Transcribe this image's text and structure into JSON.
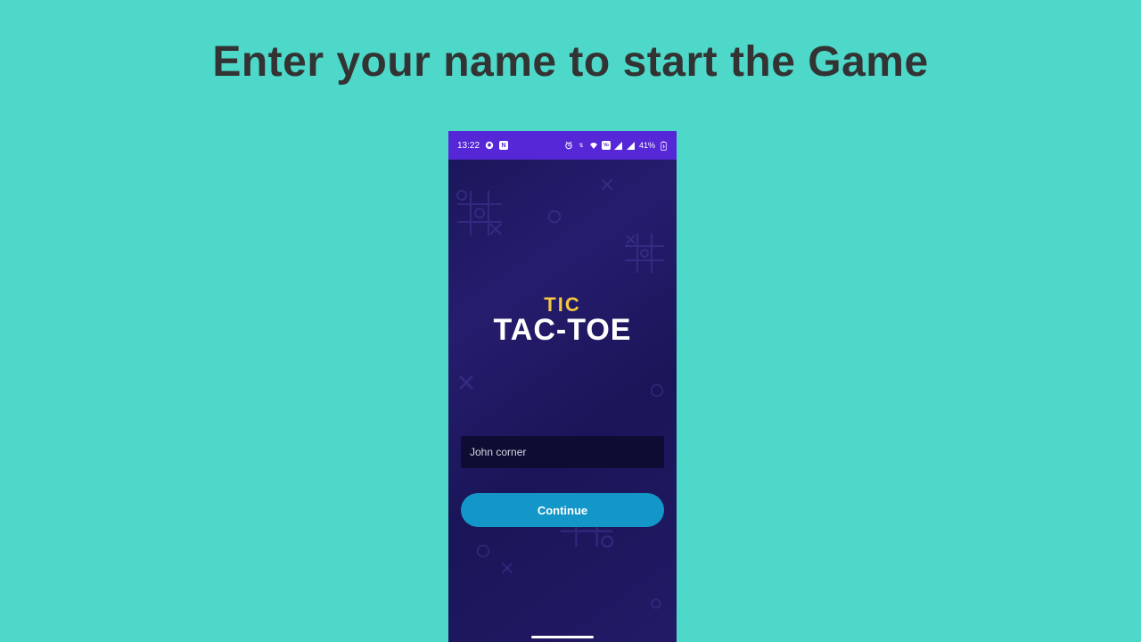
{
  "page": {
    "title": "Enter your name to start the Game"
  },
  "statusBar": {
    "time": "13:22",
    "battery": "41%"
  },
  "logo": {
    "line1": "TIC",
    "line2": "TAC-TOE"
  },
  "form": {
    "nameValue": "John corner",
    "continueLabel": "Continue"
  },
  "colors": {
    "pageBg": "#4dd8c9",
    "statusBar": "#5527d6",
    "inputBg": "#0d0d33",
    "buttonBg": "#1397c8",
    "logoAccent": "#f5c842"
  }
}
